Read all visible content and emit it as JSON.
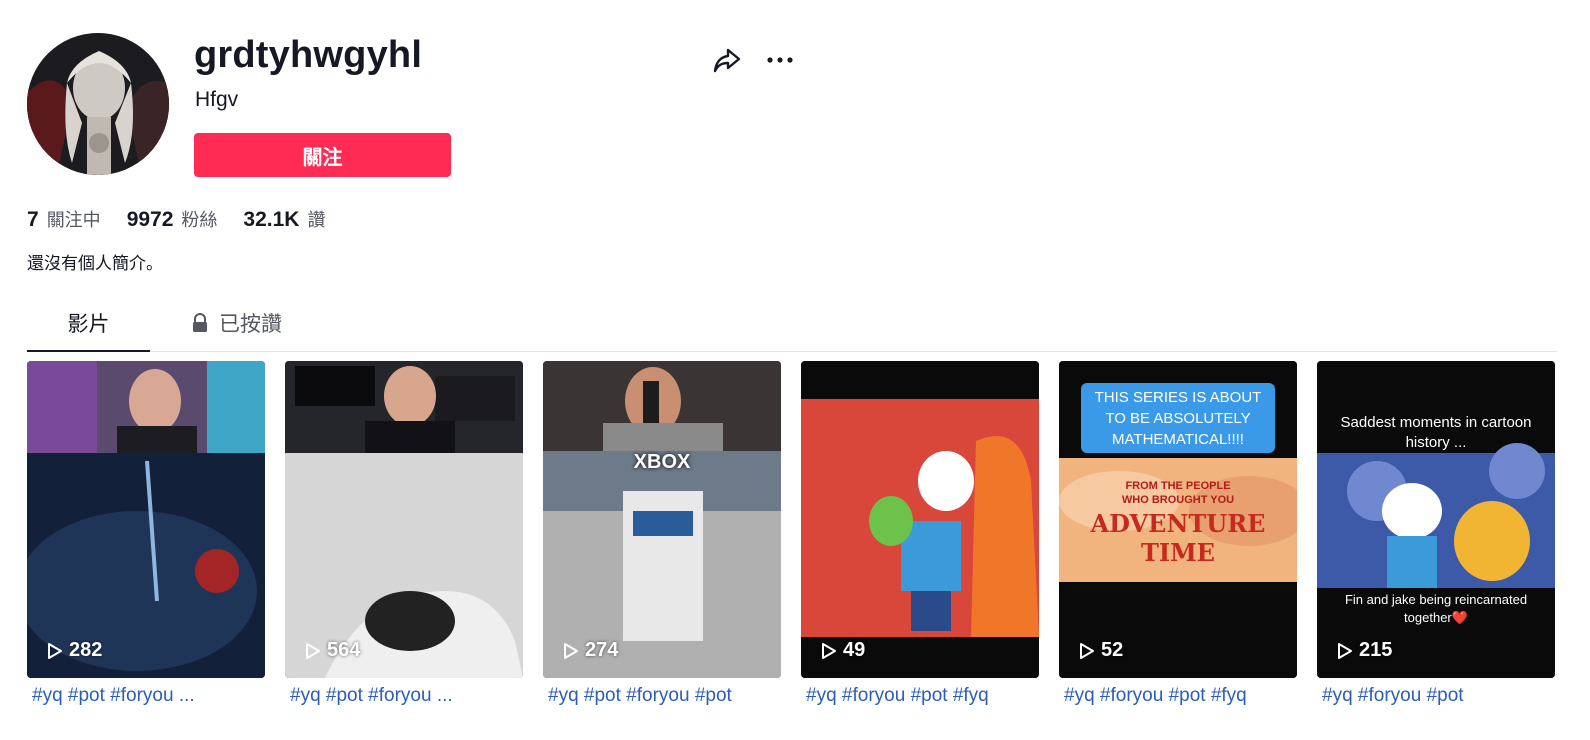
{
  "profile": {
    "username": "grdtyhwgyhl",
    "nickname": "Hfgv",
    "follow_label": "關注",
    "bio": "還沒有個人簡介。"
  },
  "stats": [
    {
      "value": "7",
      "label": "關注中"
    },
    {
      "value": "9972",
      "label": "粉絲"
    },
    {
      "value": "32.1K",
      "label": "讚"
    }
  ],
  "tabs": {
    "videos": "影片",
    "liked": "已按讚"
  },
  "videos": [
    {
      "views": "282",
      "caption": "#yq #pot #foryou ..."
    },
    {
      "views": "564",
      "caption": "#yq #pot #foryou ..."
    },
    {
      "views": "274",
      "caption": "#yq #pot #foryou #pot",
      "overlay": "XBOX"
    },
    {
      "views": "49",
      "caption": "#yq #foryou #pot #fyq"
    },
    {
      "views": "52",
      "caption": "#yq #foryou #pot #fyq",
      "overlay": "THIS SERIES IS ABOUT TO BE ABSOLUTELY MATHEMATICAL!!!!",
      "overlay2": "FROM THE PEOPLE WHO BROUGHT YOU",
      "overlay3": "ADVENTURE TIME"
    },
    {
      "views": "215",
      "caption": "#yq #foryou #pot",
      "overlay": "Saddest moments in cartoon history ...",
      "overlay2": "Fin and jake being reincarnated together❤️"
    }
  ],
  "colors": {
    "accent": "#fe2c55",
    "link": "#2b5db9"
  },
  "icons": [
    "share-icon",
    "more-icon",
    "lock-icon",
    "play-icon"
  ]
}
